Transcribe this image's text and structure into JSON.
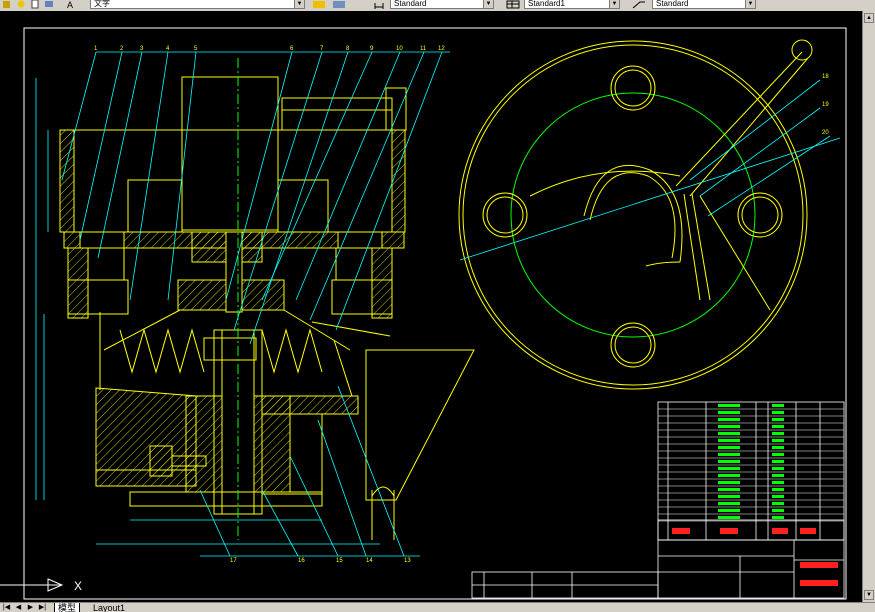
{
  "toolbar": {
    "text_style": "文字",
    "dim_style": "Standard",
    "table_style": "Standard1",
    "multileader_style": "Standard"
  },
  "colors": {
    "background": "#000000",
    "outline": "#ffff00",
    "leader": "#00ffff",
    "center": "#00ff00",
    "section": "#ff00ff",
    "frame": "#ffffff",
    "title_red": "#ff2020"
  },
  "drawing": {
    "callouts_top": [
      "1",
      "2",
      "3",
      "4",
      "5",
      "6",
      "7",
      "8",
      "9",
      "10",
      "11",
      "12"
    ],
    "callouts_bottom": [
      "17",
      "16",
      "15",
      "14",
      "13"
    ],
    "callouts_right": [
      "18",
      "19",
      "20"
    ]
  },
  "ucs": {
    "axis_label": "X"
  },
  "layout_tabs": {
    "model": "模型",
    "layout1": "Layout1"
  }
}
